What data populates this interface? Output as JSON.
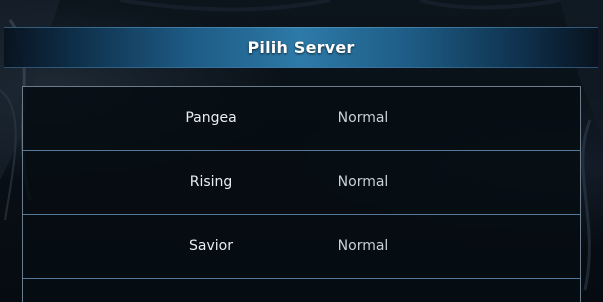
{
  "dialog": {
    "title": "Pilih Server"
  },
  "servers": [
    {
      "name": "Pangea",
      "status": "Normal"
    },
    {
      "name": "Rising",
      "status": "Normal"
    },
    {
      "name": "Savior",
      "status": "Normal"
    }
  ],
  "colors": {
    "header_accent": "#2d7aa8",
    "row_divider": "#56789a",
    "text_primary": "#e9eef2"
  }
}
